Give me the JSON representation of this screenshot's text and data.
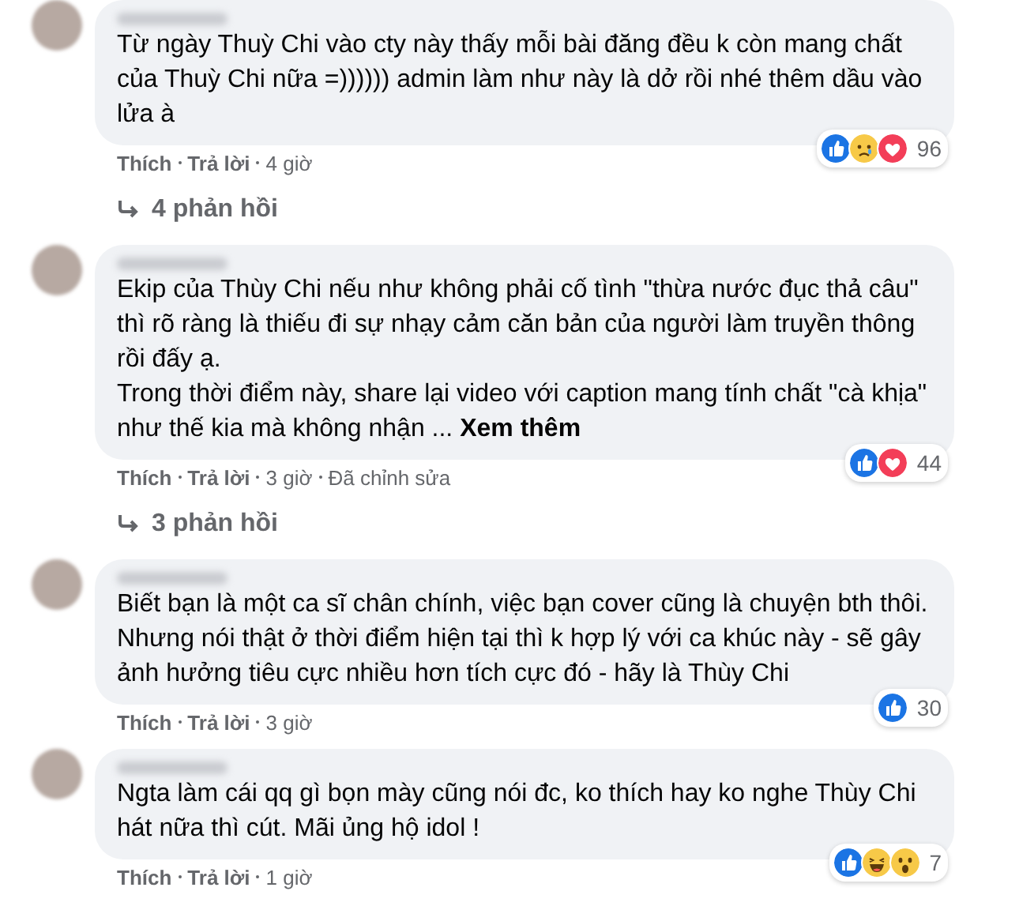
{
  "comments": [
    {
      "text": "Từ ngày Thuỳ Chi vào cty này thấy mỗi bài đăng đều k còn mang chất của Thuỳ Chi nữa =)))))) admin làm như này là dở rồi nhé thêm dầu vào lửa à",
      "reactions": [
        {
          "kind": "like"
        },
        {
          "kind": "sad"
        },
        {
          "kind": "love"
        }
      ],
      "reaction_count": "96",
      "actions": {
        "like": "Thích",
        "reply": "Trả lời",
        "time": "4 giờ"
      },
      "replies": "4 phản hồi"
    },
    {
      "text": "Ekip của Thùy Chi nếu như không phải cố tình \"thừa nước đục thả câu\" thì rõ ràng là thiếu đi sự nhạy cảm căn bản của người làm truyền thông rồi đấy ạ.\nTrong thời điểm này, share lại video với caption mang tính chất \"cà khịa\" như thế kia mà không nhận ... **Xem thêm**",
      "reactions": [
        {
          "kind": "like"
        },
        {
          "kind": "love"
        }
      ],
      "reaction_count": "44",
      "actions": {
        "like": "Thích",
        "reply": "Trả lời",
        "time": "3 giờ",
        "edited": "Đã chỉnh sửa"
      },
      "replies": "3 phản hồi"
    },
    {
      "text": "Biết bạn là một ca sĩ chân chính, việc bạn cover cũng là chuyện bth thôi. Nhưng nói thật ở thời điểm hiện tại thì k hợp lý với ca khúc này - sẽ gây ảnh hưởng tiêu cực nhiều hơn tích cực đó - hãy là Thùy Chi",
      "reactions": [
        {
          "kind": "like"
        }
      ],
      "reaction_count": "30",
      "actions": {
        "like": "Thích",
        "reply": "Trả lời",
        "time": "3 giờ"
      }
    },
    {
      "text": "Ngta làm cái qq gì bọn mày cũng nói đc, ko thích hay ko nghe Thùy Chi hát nữa thì cút. Mãi ủng hộ idol !",
      "reactions": [
        {
          "kind": "like"
        },
        {
          "kind": "haha"
        },
        {
          "kind": "wow"
        }
      ],
      "reaction_count": "7",
      "actions": {
        "like": "Thích",
        "reply": "Trả lời",
        "time": "1 giờ"
      }
    }
  ]
}
